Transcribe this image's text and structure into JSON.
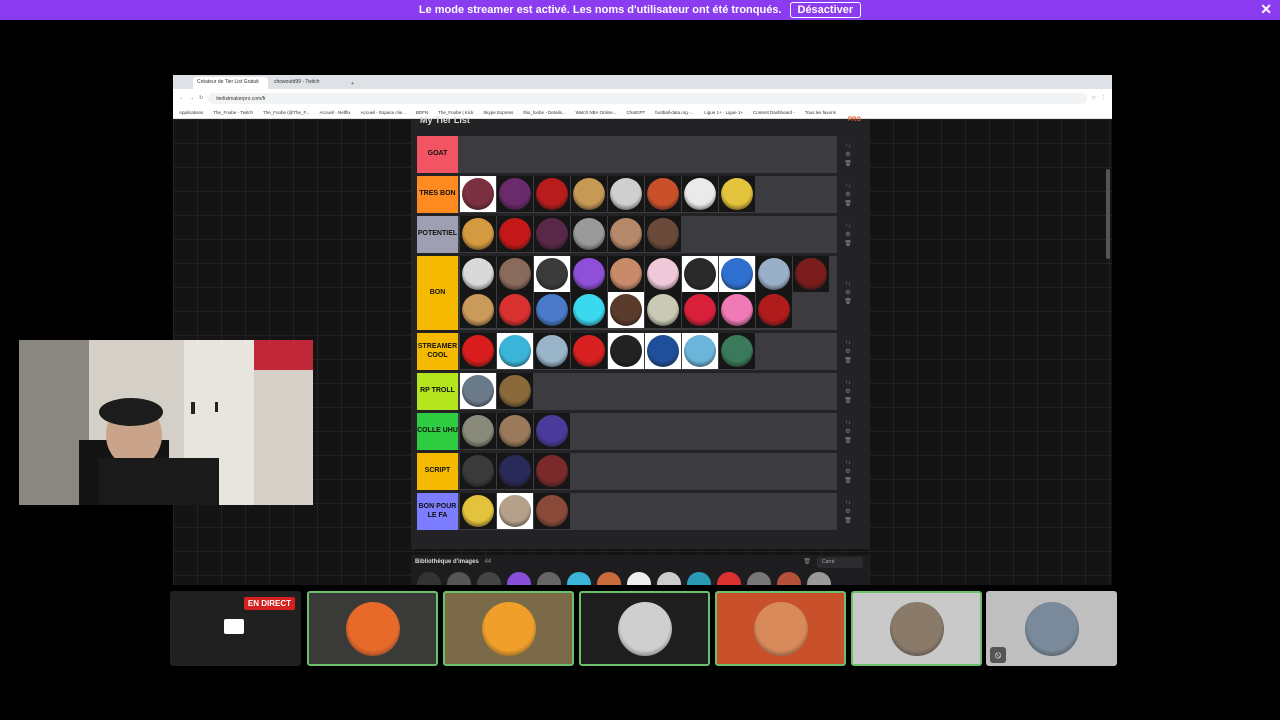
{
  "banner": {
    "message": "Le mode streamer est activé. Les noms d'utilisateur ont été tronqués.",
    "button_label": "Désactiver",
    "close_glyph": "✕"
  },
  "browser": {
    "tabs": [
      "Créateur de Tier List Gratuit",
      "chowoutd99 - Twitch"
    ],
    "new_tab_glyph": "+",
    "url": "tierlistmakerpro.com/fr",
    "bookmarks": [
      "Applications",
      "The_Foobe - Twitch",
      "The_Foobe (@The_F...",
      "Accueil - Netflix",
      "Accueil - Espace clie...",
      "BDFN",
      "The_Foobe | Kick",
      "Skype Express",
      "this_foobe - Details...",
      "Watch NBA Online...",
      "ChatGPT",
      "football-data.org -...",
      "Ligue 1+ - Ligue 1+",
      "Content Dashboard -",
      "Tous les favoris"
    ]
  },
  "tierlist": {
    "title": "My Tier List",
    "brand": "PRO",
    "tiers": [
      {
        "label": "GOAT",
        "color": "#f25464",
        "rows": 1,
        "items": []
      },
      {
        "label": "TRES BON",
        "color": "#ff8a1f",
        "rows": 1,
        "items": [
          {
            "color": "#7a3040",
            "light": true
          },
          {
            "color": "#6b2a6b"
          },
          {
            "color": "#b81c1c"
          },
          {
            "color": "#c69a52"
          },
          {
            "color": "#cfcfcf"
          },
          {
            "color": "#c9502a"
          },
          {
            "color": "#eaeaea"
          },
          {
            "color": "#e3c23c"
          }
        ]
      },
      {
        "label": "POTENTIEL",
        "color": "#9f9fb3",
        "rows": 1,
        "items": [
          {
            "color": "#d49a40"
          },
          {
            "color": "#c41818"
          },
          {
            "color": "#5a2848"
          },
          {
            "color": "#9a9a9a"
          },
          {
            "color": "#b5886a"
          },
          {
            "color": "#6a4a3a"
          }
        ]
      },
      {
        "label": "BON",
        "color": "#f5b900",
        "rows": 2,
        "items": [
          {
            "color": "#d9d9d9"
          },
          {
            "color": "#8a6a5a"
          },
          {
            "color": "#3a3a3a",
            "light": true
          },
          {
            "color": "#8f4fd9"
          },
          {
            "color": "#c98a6a"
          },
          {
            "color": "#f0c9d9"
          },
          {
            "color": "#2a2a2a",
            "light": true
          },
          {
            "color": "#2f6fcf",
            "light": true
          },
          {
            "color": "#9ab0c9"
          },
          {
            "color": "#7a1c1c"
          },
          {
            "color": "#c99a5a"
          },
          {
            "color": "#d93030"
          },
          {
            "color": "#4a7ac9"
          },
          {
            "color": "#3ad9f0"
          },
          {
            "color": "#5a3a2a",
            "light": true
          },
          {
            "color": "#c9c9b5"
          },
          {
            "color": "#d9203a"
          },
          {
            "color": "#f07ab5"
          },
          {
            "color": "#b01c1c"
          }
        ]
      },
      {
        "label": "STREAMER COOL",
        "color": "#f5b900",
        "rows": 1,
        "items": [
          {
            "color": "#d91c1c"
          },
          {
            "color": "#3ab5d9",
            "light": true
          },
          {
            "color": "#9ab5c9"
          },
          {
            "color": "#d92020"
          },
          {
            "color": "#222222",
            "light": true
          },
          {
            "color": "#1f4f9a",
            "light": true
          },
          {
            "color": "#6ab5d9",
            "light": true
          },
          {
            "color": "#3a7a5a"
          }
        ]
      },
      {
        "label": "RP TROLL",
        "color": "#b5e61d",
        "rows": 1,
        "items": [
          {
            "color": "#6a7a8a",
            "light": true
          },
          {
            "color": "#8a6a3a"
          }
        ]
      },
      {
        "label": "COLLE UHU",
        "color": "#2ecc40",
        "rows": 1,
        "items": [
          {
            "color": "#8a8a7a"
          },
          {
            "color": "#9a7a5a"
          },
          {
            "color": "#4a3a9a"
          }
        ]
      },
      {
        "label": "SCRIPT",
        "color": "#f5b900",
        "rows": 1,
        "items": [
          {
            "color": "#3a3a3a"
          },
          {
            "color": "#2a2a5a"
          },
          {
            "color": "#7a2a2a"
          }
        ]
      },
      {
        "label": "BON POUR LE FA",
        "color": "#7d7dff",
        "rows": 1,
        "items": [
          {
            "color": "#e3c23c"
          },
          {
            "color": "#b5a08a",
            "light": true
          },
          {
            "color": "#8a4a3a"
          }
        ]
      }
    ],
    "controls": [
      "↑↓",
      "⚙",
      "🗑"
    ]
  },
  "library": {
    "label": "Bibliothèque d'images",
    "count": "44",
    "select_label": "Carré",
    "thumbs": [
      "#333",
      "#555",
      "#444",
      "#8a4fd9",
      "#666",
      "#3ab5d9",
      "#c96a3a",
      "#eee",
      "#ccc",
      "#2a9ab5",
      "#d93030",
      "#777",
      "#b5503a",
      "#999"
    ]
  },
  "participants": [
    {
      "name": "screen-share",
      "live_label": "EN DIRECT",
      "bg": "#202020",
      "speaking": false
    },
    {
      "name": "participant-fish-orange",
      "bg": "#3a3a38",
      "avatar": "#e86a2a",
      "speaking": true
    },
    {
      "name": "participant-goldfish",
      "bg": "#7a6a48",
      "avatar": "#f0a02a",
      "speaking": true
    },
    {
      "name": "participant-bw-photo",
      "bg": "#1e1e1e",
      "avatar": "#cfcfcf",
      "speaking": true
    },
    {
      "name": "participant-bearded",
      "bg": "#c8502a",
      "avatar": "#d98a5a",
      "speaking": true
    },
    {
      "name": "participant-skater",
      "bg": "#c9c9c9",
      "avatar": "#8a7a6a",
      "speaking": true
    },
    {
      "name": "participant-runner",
      "bg": "#bfbfbf",
      "avatar": "#7a8a9a",
      "speaking": false,
      "muted": true
    }
  ]
}
